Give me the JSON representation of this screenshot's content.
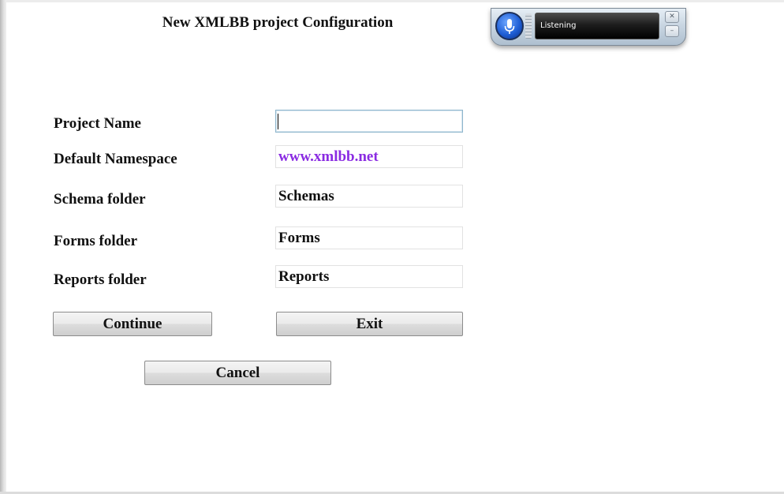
{
  "window": {
    "title": "New XMLBB project Configuration"
  },
  "form": {
    "project_name": {
      "label": "Project Name",
      "value": ""
    },
    "default_namespace": {
      "label": "Default Namespace",
      "value": "www.xmlbb.net"
    },
    "schema_folder": {
      "label": "Schema folder",
      "value": "Schemas"
    },
    "forms_folder": {
      "label": "Forms folder",
      "value": "Forms"
    },
    "reports_folder": {
      "label": "Reports folder",
      "value": "Reports"
    }
  },
  "buttons": {
    "continue": "Continue",
    "exit": "Exit",
    "cancel": "Cancel"
  },
  "speech_widget": {
    "status": "Listening",
    "mic_icon": "microphone-icon",
    "close_icon": "close-icon",
    "minimize_icon": "minimize-icon"
  },
  "colors": {
    "namespace_text": "#8a2be2",
    "active_field_border": "#8fb6cd"
  }
}
